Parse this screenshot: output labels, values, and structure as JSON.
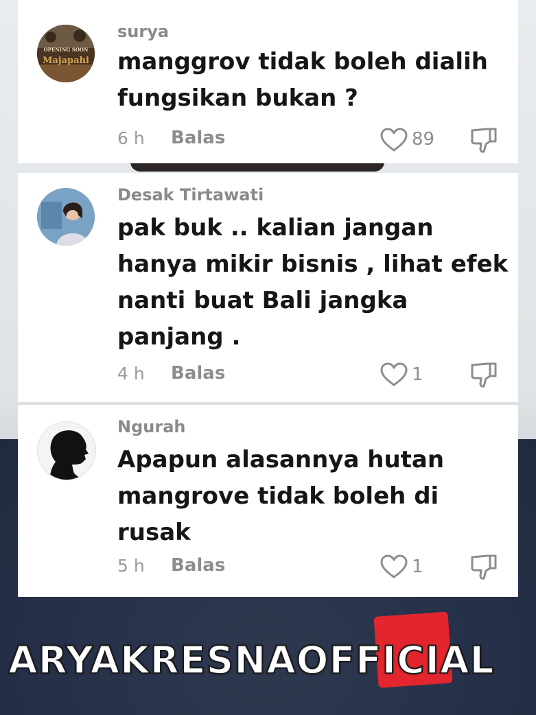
{
  "comments": [
    {
      "username": "surya",
      "text": "manggrov tidak boleh dialih fungsikan bukan ?",
      "time": "6 h",
      "reply_label": "Balas",
      "likes": "89",
      "avatar": {
        "text_line1": "OPENING SOON",
        "text_line2": "Majapahi"
      }
    },
    {
      "username": "Desak Tirtawati",
      "text": "pak buk .. kalian jangan hanya mikir bisnis , lihat efek nanti buat Bali jangka panjang .",
      "time": "4 h",
      "reply_label": "Balas",
      "likes": "1"
    },
    {
      "username": "Ngurah",
      "text": "Apapun alasannya hutan mangrove tidak boleh di rusak",
      "time": "5 h",
      "reply_label": "Balas",
      "likes": "1"
    }
  ],
  "watermark": "ARYAKRESNAOFFICIAL",
  "icons": {
    "like": "heart-outline-icon",
    "dislike": "thumbs-down-icon"
  }
}
